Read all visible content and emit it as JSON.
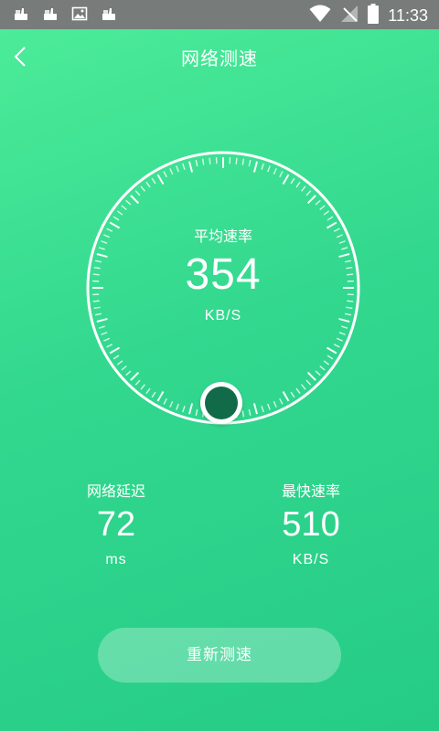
{
  "status_bar": {
    "time": "11:33",
    "left_icons": [
      "notification-icon",
      "notification-icon",
      "image-icon",
      "notification-icon"
    ],
    "right_icons": [
      "wifi-icon",
      "no-signal-icon",
      "battery-icon"
    ]
  },
  "header": {
    "title": "网络测速",
    "back_icon": "back-chevron-icon"
  },
  "gauge": {
    "label": "平均速率",
    "value": "354",
    "unit": "KB/S"
  },
  "stats": {
    "latency": {
      "label": "网络延迟",
      "value": "72",
      "unit": "ms"
    },
    "fastest": {
      "label": "最快速率",
      "value": "510",
      "unit": "KB/S"
    }
  },
  "actions": {
    "retest_label": "重新测速"
  },
  "colors": {
    "background_top": "#4ded99",
    "background_bottom": "#25cc86",
    "status_bar": "#777b7a",
    "knob_inner": "#126b48",
    "text": "#ffffff"
  }
}
